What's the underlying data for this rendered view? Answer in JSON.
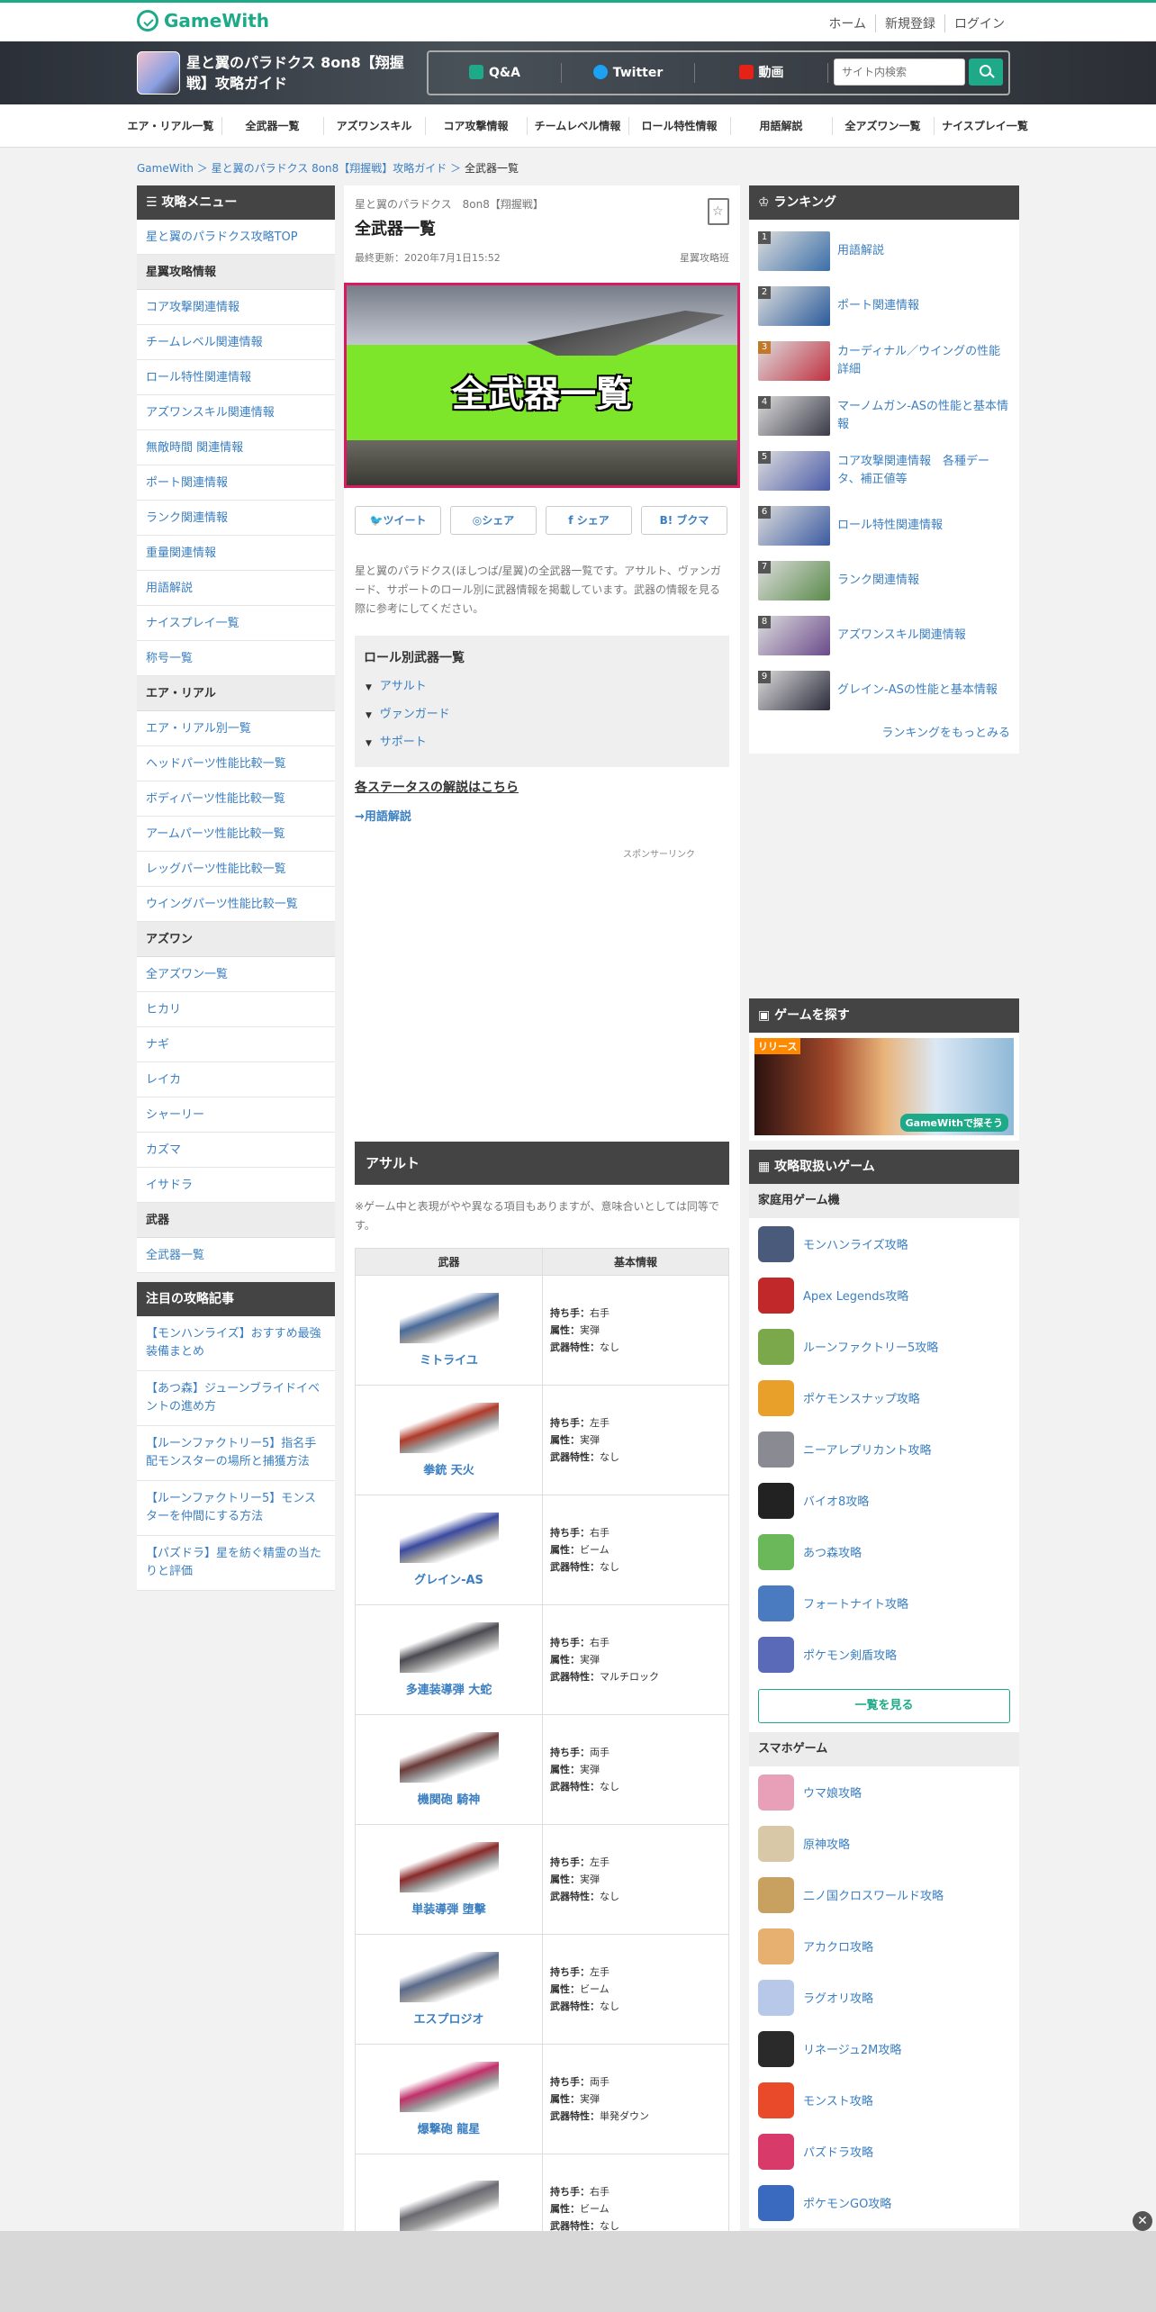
{
  "header": {
    "logo": "GameWith",
    "links": [
      "ホーム",
      "新規登録",
      "ログイン"
    ]
  },
  "banner": {
    "game_title": "星と翼のパラドクス 8on8【翔握戦】攻略ガイド",
    "nav": [
      "Q&A",
      "Twitter",
      "動画"
    ],
    "search_placeholder": "サイト内検索"
  },
  "menubar": [
    "エア・リアル一覧",
    "全武器一覧",
    "アズワンスキル",
    "コア攻撃情報",
    "チームレベル情報",
    "ロール特性情報",
    "用語解説",
    "全アズワン一覧",
    "ナイスプレイ一覧"
  ],
  "breadcrumb": {
    "home": "GameWith",
    "guide": "星と翼のパラドクス 8on8【翔握戦】攻略ガイド",
    "current": "全武器一覧"
  },
  "left_menu": {
    "title": "攻略メニュー",
    "items": [
      {
        "type": "link",
        "label": "星と翼のパラドクス攻略TOP"
      },
      {
        "type": "cat",
        "label": "星翼攻略情報"
      },
      {
        "type": "link",
        "label": "コア攻撃関連情報"
      },
      {
        "type": "link",
        "label": "チームレベル関連情報"
      },
      {
        "type": "link",
        "label": "ロール特性関連情報"
      },
      {
        "type": "link",
        "label": "アズワンスキル関連情報"
      },
      {
        "type": "link",
        "label": "無敵時間 関連情報"
      },
      {
        "type": "link",
        "label": "ポート関連情報"
      },
      {
        "type": "link",
        "label": "ランク関連情報"
      },
      {
        "type": "link",
        "label": "重量関連情報"
      },
      {
        "type": "link",
        "label": "用語解説"
      },
      {
        "type": "link",
        "label": "ナイスプレイ一覧"
      },
      {
        "type": "link",
        "label": "称号一覧"
      },
      {
        "type": "cat",
        "label": "エア・リアル"
      },
      {
        "type": "link",
        "label": "エア・リアル別一覧"
      },
      {
        "type": "link",
        "label": "ヘッドパーツ性能比較一覧"
      },
      {
        "type": "link",
        "label": "ボディパーツ性能比較一覧"
      },
      {
        "type": "link",
        "label": "アームパーツ性能比較一覧"
      },
      {
        "type": "link",
        "label": "レッグパーツ性能比較一覧"
      },
      {
        "type": "link",
        "label": "ウイングパーツ性能比較一覧"
      },
      {
        "type": "cat",
        "label": "アズワン"
      },
      {
        "type": "link",
        "label": "全アズワン一覧"
      },
      {
        "type": "link",
        "label": "ヒカリ"
      },
      {
        "type": "link",
        "label": "ナギ"
      },
      {
        "type": "link",
        "label": "レイカ"
      },
      {
        "type": "link",
        "label": "シャーリー"
      },
      {
        "type": "link",
        "label": "カズマ"
      },
      {
        "type": "link",
        "label": "イサドラ"
      },
      {
        "type": "cat",
        "label": "武器"
      },
      {
        "type": "link",
        "label": "全武器一覧"
      }
    ],
    "featured_title": "注目の攻略記事",
    "featured": [
      "【モンハンライズ】おすすめ最強装備まとめ",
      "【あつ森】ジューンブライドイベントの進め方",
      "【ルーンファクトリー5】指名手配モンスターの場所と捕獲方法",
      "【ルーンファクトリー5】モンスターを仲間にする方法",
      "【パズドラ】星を紡ぐ精霊の当たりと評価"
    ]
  },
  "article": {
    "game_name": "星と翼のパラドクス　8on8【翔握戦】",
    "title": "全武器一覧",
    "updated": "最終更新：2020年7月1日15:52",
    "author": "星翼攻略班",
    "hero_text": "全武器一覧",
    "share": [
      "ツイート",
      "シェア",
      "シェア",
      "ブクマ"
    ],
    "lead": "星と翼のパラドクス(ほしつば/星翼)の全武器一覧です。アサルト、ヴァンガード、サポートのロール別に武器情報を掲載しています。武器の情報を見る際に参考にしてください。",
    "toc_title": "ロール別武器一覧",
    "toc": [
      "アサルト",
      "ヴァンガード",
      "サポート"
    ],
    "status_link": "各ステータスの解説はこちら",
    "term_link": "→用語解説",
    "sponsor": "スポンサーリンク",
    "section_title": "アサルト",
    "note": "※ゲーム中と表現がやや異なる項目もありますが、意味合いとしては同等です。",
    "table_headers": [
      "武器",
      "基本情報"
    ],
    "labels": {
      "hand": "持ち手：",
      "attr": "属性：",
      "trait": "武器特性："
    },
    "weapons": [
      {
        "name": "ミトライユ",
        "hand": "右手",
        "attr": "実弾",
        "trait": "なし",
        "color": "#4a6a9a"
      },
      {
        "name": "拳銃 天火",
        "hand": "左手",
        "attr": "実弾",
        "trait": "なし",
        "color": "#b03a2a"
      },
      {
        "name": "グレイン-AS",
        "hand": "右手",
        "attr": "ビーム",
        "trait": "なし",
        "color": "#3a4aa0"
      },
      {
        "name": "多連装導弾 大蛇",
        "hand": "右手",
        "attr": "実弾",
        "trait": "マルチロック",
        "color": "#4a4a52"
      },
      {
        "name": "機関砲 騎神",
        "hand": "両手",
        "attr": "実弾",
        "trait": "なし",
        "color": "#6a3a38"
      },
      {
        "name": "単装導弾 堕擊",
        "hand": "左手",
        "attr": "実弾",
        "trait": "なし",
        "color": "#8a2a2a"
      },
      {
        "name": "エスプロジオ",
        "hand": "左手",
        "attr": "ビーム",
        "trait": "なし",
        "color": "#5a6a8a"
      },
      {
        "name": "爆撃砲 龍星",
        "hand": "両手",
        "attr": "実弾",
        "trait": "単発ダウン",
        "color": "#c0306a"
      },
      {
        "name": "",
        "hand": "右手",
        "attr": "ビーム",
        "trait": "なし",
        "color": "#6a6a72"
      }
    ]
  },
  "ranking": {
    "title": "ランキング",
    "items": [
      {
        "rank": "1",
        "label": "用語解説",
        "color": "#3a6ea8"
      },
      {
        "rank": "2",
        "label": "ポート関連情報",
        "color": "#2a5a9a"
      },
      {
        "rank": "3",
        "label": "カーディナル／ウイングの性能詳細",
        "color": "#c03040"
      },
      {
        "rank": "4",
        "label": "マーノムガン-ASの性能と基本情報",
        "color": "#3a3a48"
      },
      {
        "rank": "5",
        "label": "コア攻撃関連情報　各種データ、補正値等",
        "color": "#4a5aa8"
      },
      {
        "rank": "6",
        "label": "ロール特性関連情報",
        "color": "#3a5aa0"
      },
      {
        "rank": "7",
        "label": "ランク関連情報",
        "color": "#5a8a4a"
      },
      {
        "rank": "8",
        "label": "アズワンスキル関連情報",
        "color": "#6a4a8a"
      },
      {
        "rank": "9",
        "label": "グレイン-ASの性能と基本情報",
        "color": "#2a2a3a"
      }
    ],
    "more": "ランキングをもっとみる"
  },
  "game_search": {
    "title": "ゲームを探す",
    "banner_badge": "リリース",
    "banner_tag": "GameWithで探そう"
  },
  "games": {
    "title": "攻略取扱いゲーム",
    "console_title": "家庭用ゲーム機",
    "console": [
      {
        "label": "モンハンライズ攻略",
        "color": "#4a5a7a"
      },
      {
        "label": "Apex Legends攻略",
        "color": "#c0282a"
      },
      {
        "label": "ルーンファクトリー5攻略",
        "color": "#7aa84a"
      },
      {
        "label": "ポケモンスナップ攻略",
        "color": "#e8a02a"
      },
      {
        "label": "ニーアレプリカント攻略",
        "color": "#8a8a92"
      },
      {
        "label": "バイオ8攻略",
        "color": "#222"
      },
      {
        "label": "あつ森攻略",
        "color": "#6ab85a"
      },
      {
        "label": "フォートナイト攻略",
        "color": "#4a7ac0"
      },
      {
        "label": "ポケモン剣盾攻略",
        "color": "#5a6ab8"
      }
    ],
    "see_all": "一覧を見る",
    "mobile_title": "スマホゲーム",
    "mobile": [
      {
        "label": "ウマ娘攻略",
        "color": "#e8a0b8"
      },
      {
        "label": "原神攻略",
        "color": "#d8c8a8"
      },
      {
        "label": "二ノ国クロスワールド攻略",
        "color": "#c8a060"
      },
      {
        "label": "アカクロ攻略",
        "color": "#e8b070"
      },
      {
        "label": "ラグオリ攻略",
        "color": "#b8c8e8"
      },
      {
        "label": "リネージュ2M攻略",
        "color": "#2a2a2a"
      },
      {
        "label": "モンスト攻略",
        "color": "#e84a2a"
      },
      {
        "label": "パズドラ攻略",
        "color": "#d83a6a"
      },
      {
        "label": "ポケモンGO攻略",
        "color": "#3a6ac0"
      }
    ]
  }
}
